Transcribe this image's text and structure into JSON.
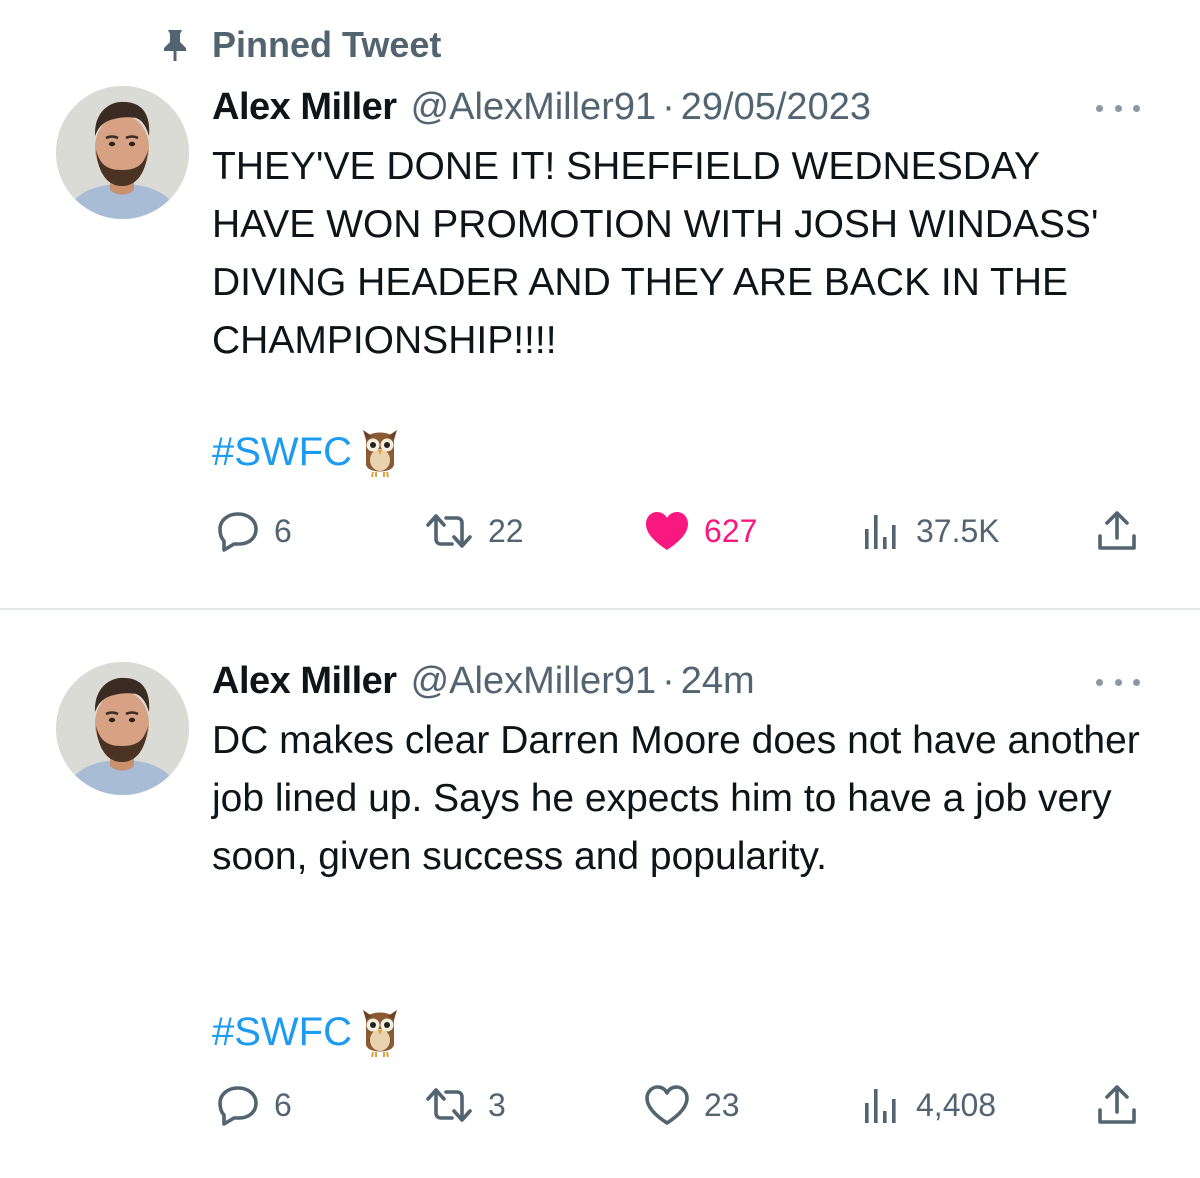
{
  "pinned": {
    "label": "Pinned Tweet",
    "icon": "pin-icon"
  },
  "tweets": [
    {
      "name": "Alex Miller",
      "handle": "@AlexMiller91",
      "separator": "·",
      "time": "29/05/2023",
      "text": "THEY'VE DONE IT! SHEFFIELD WEDNESDAY HAVE WON PROMOTION WITH JOSH WINDASS' DIVING HEADER AND THEY ARE BACK IN THE CHAMPIONSHIP!!!!",
      "hashtag": "#SWFC",
      "replies": "6",
      "retweets": "22",
      "likes": "627",
      "liked": true,
      "views": "37.5K"
    },
    {
      "name": "Alex Miller",
      "handle": "@AlexMiller91",
      "separator": "·",
      "time": "24m",
      "text": "DC makes clear Darren Moore does not have another job lined up. Says he expects him to have a job very soon, given success and popularity.",
      "hashtag": "#SWFC",
      "replies": "6",
      "retweets": "3",
      "likes": "23",
      "liked": false,
      "views": "4,408"
    }
  ],
  "colors": {
    "text": "#0f1419",
    "secondary": "#536471",
    "link": "#1d9bf0",
    "like": "#f91880",
    "divider": "#e6e9ec"
  }
}
